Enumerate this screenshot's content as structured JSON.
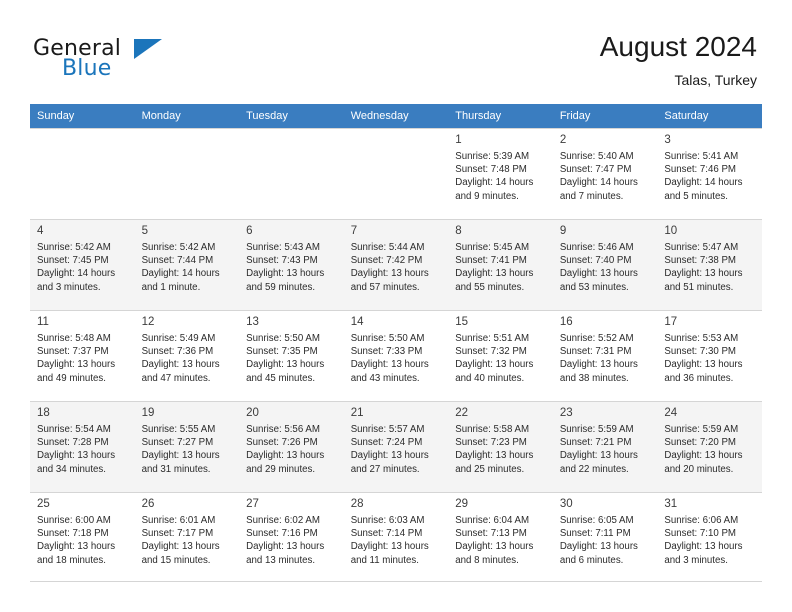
{
  "brand": {
    "word1": "General",
    "word2": "Blue",
    "triangle_color": "#1b75bb",
    "icon": "triangle-logo-icon"
  },
  "header": {
    "title": "August 2024",
    "subtitle": "Talas, Turkey"
  },
  "calendar": {
    "header_bg": "#3a7dc0",
    "columns": [
      "Sunday",
      "Monday",
      "Tuesday",
      "Wednesday",
      "Thursday",
      "Friday",
      "Saturday"
    ],
    "weeks": [
      [
        {
          "day": "",
          "lines": [
            "",
            "",
            "",
            ""
          ],
          "empty": true
        },
        {
          "day": "",
          "lines": [
            "",
            "",
            "",
            ""
          ],
          "empty": true
        },
        {
          "day": "",
          "lines": [
            "",
            "",
            "",
            ""
          ],
          "empty": true
        },
        {
          "day": "",
          "lines": [
            "",
            "",
            "",
            ""
          ],
          "empty": true
        },
        {
          "day": "1",
          "lines": [
            "Sunrise: 5:39 AM",
            "Sunset: 7:48 PM",
            "Daylight: 14 hours",
            "and 9 minutes."
          ]
        },
        {
          "day": "2",
          "lines": [
            "Sunrise: 5:40 AM",
            "Sunset: 7:47 PM",
            "Daylight: 14 hours",
            "and 7 minutes."
          ]
        },
        {
          "day": "3",
          "lines": [
            "Sunrise: 5:41 AM",
            "Sunset: 7:46 PM",
            "Daylight: 14 hours",
            "and 5 minutes."
          ]
        }
      ],
      [
        {
          "day": "4",
          "lines": [
            "Sunrise: 5:42 AM",
            "Sunset: 7:45 PM",
            "Daylight: 14 hours",
            "and 3 minutes."
          ]
        },
        {
          "day": "5",
          "lines": [
            "Sunrise: 5:42 AM",
            "Sunset: 7:44 PM",
            "Daylight: 14 hours",
            "and 1 minute."
          ]
        },
        {
          "day": "6",
          "lines": [
            "Sunrise: 5:43 AM",
            "Sunset: 7:43 PM",
            "Daylight: 13 hours",
            "and 59 minutes."
          ]
        },
        {
          "day": "7",
          "lines": [
            "Sunrise: 5:44 AM",
            "Sunset: 7:42 PM",
            "Daylight: 13 hours",
            "and 57 minutes."
          ]
        },
        {
          "day": "8",
          "lines": [
            "Sunrise: 5:45 AM",
            "Sunset: 7:41 PM",
            "Daylight: 13 hours",
            "and 55 minutes."
          ]
        },
        {
          "day": "9",
          "lines": [
            "Sunrise: 5:46 AM",
            "Sunset: 7:40 PM",
            "Daylight: 13 hours",
            "and 53 minutes."
          ]
        },
        {
          "day": "10",
          "lines": [
            "Sunrise: 5:47 AM",
            "Sunset: 7:38 PM",
            "Daylight: 13 hours",
            "and 51 minutes."
          ]
        }
      ],
      [
        {
          "day": "11",
          "lines": [
            "Sunrise: 5:48 AM",
            "Sunset: 7:37 PM",
            "Daylight: 13 hours",
            "and 49 minutes."
          ]
        },
        {
          "day": "12",
          "lines": [
            "Sunrise: 5:49 AM",
            "Sunset: 7:36 PM",
            "Daylight: 13 hours",
            "and 47 minutes."
          ]
        },
        {
          "day": "13",
          "lines": [
            "Sunrise: 5:50 AM",
            "Sunset: 7:35 PM",
            "Daylight: 13 hours",
            "and 45 minutes."
          ]
        },
        {
          "day": "14",
          "lines": [
            "Sunrise: 5:50 AM",
            "Sunset: 7:33 PM",
            "Daylight: 13 hours",
            "and 43 minutes."
          ]
        },
        {
          "day": "15",
          "lines": [
            "Sunrise: 5:51 AM",
            "Sunset: 7:32 PM",
            "Daylight: 13 hours",
            "and 40 minutes."
          ]
        },
        {
          "day": "16",
          "lines": [
            "Sunrise: 5:52 AM",
            "Sunset: 7:31 PM",
            "Daylight: 13 hours",
            "and 38 minutes."
          ]
        },
        {
          "day": "17",
          "lines": [
            "Sunrise: 5:53 AM",
            "Sunset: 7:30 PM",
            "Daylight: 13 hours",
            "and 36 minutes."
          ]
        }
      ],
      [
        {
          "day": "18",
          "lines": [
            "Sunrise: 5:54 AM",
            "Sunset: 7:28 PM",
            "Daylight: 13 hours",
            "and 34 minutes."
          ]
        },
        {
          "day": "19",
          "lines": [
            "Sunrise: 5:55 AM",
            "Sunset: 7:27 PM",
            "Daylight: 13 hours",
            "and 31 minutes."
          ]
        },
        {
          "day": "20",
          "lines": [
            "Sunrise: 5:56 AM",
            "Sunset: 7:26 PM",
            "Daylight: 13 hours",
            "and 29 minutes."
          ]
        },
        {
          "day": "21",
          "lines": [
            "Sunrise: 5:57 AM",
            "Sunset: 7:24 PM",
            "Daylight: 13 hours",
            "and 27 minutes."
          ]
        },
        {
          "day": "22",
          "lines": [
            "Sunrise: 5:58 AM",
            "Sunset: 7:23 PM",
            "Daylight: 13 hours",
            "and 25 minutes."
          ]
        },
        {
          "day": "23",
          "lines": [
            "Sunrise: 5:59 AM",
            "Sunset: 7:21 PM",
            "Daylight: 13 hours",
            "and 22 minutes."
          ]
        },
        {
          "day": "24",
          "lines": [
            "Sunrise: 5:59 AM",
            "Sunset: 7:20 PM",
            "Daylight: 13 hours",
            "and 20 minutes."
          ]
        }
      ],
      [
        {
          "day": "25",
          "lines": [
            "Sunrise: 6:00 AM",
            "Sunset: 7:18 PM",
            "Daylight: 13 hours",
            "and 18 minutes."
          ]
        },
        {
          "day": "26",
          "lines": [
            "Sunrise: 6:01 AM",
            "Sunset: 7:17 PM",
            "Daylight: 13 hours",
            "and 15 minutes."
          ]
        },
        {
          "day": "27",
          "lines": [
            "Sunrise: 6:02 AM",
            "Sunset: 7:16 PM",
            "Daylight: 13 hours",
            "and 13 minutes."
          ]
        },
        {
          "day": "28",
          "lines": [
            "Sunrise: 6:03 AM",
            "Sunset: 7:14 PM",
            "Daylight: 13 hours",
            "and 11 minutes."
          ]
        },
        {
          "day": "29",
          "lines": [
            "Sunrise: 6:04 AM",
            "Sunset: 7:13 PM",
            "Daylight: 13 hours",
            "and 8 minutes."
          ]
        },
        {
          "day": "30",
          "lines": [
            "Sunrise: 6:05 AM",
            "Sunset: 7:11 PM",
            "Daylight: 13 hours",
            "and 6 minutes."
          ]
        },
        {
          "day": "31",
          "lines": [
            "Sunrise: 6:06 AM",
            "Sunset: 7:10 PM",
            "Daylight: 13 hours",
            "and 3 minutes."
          ]
        }
      ]
    ]
  }
}
